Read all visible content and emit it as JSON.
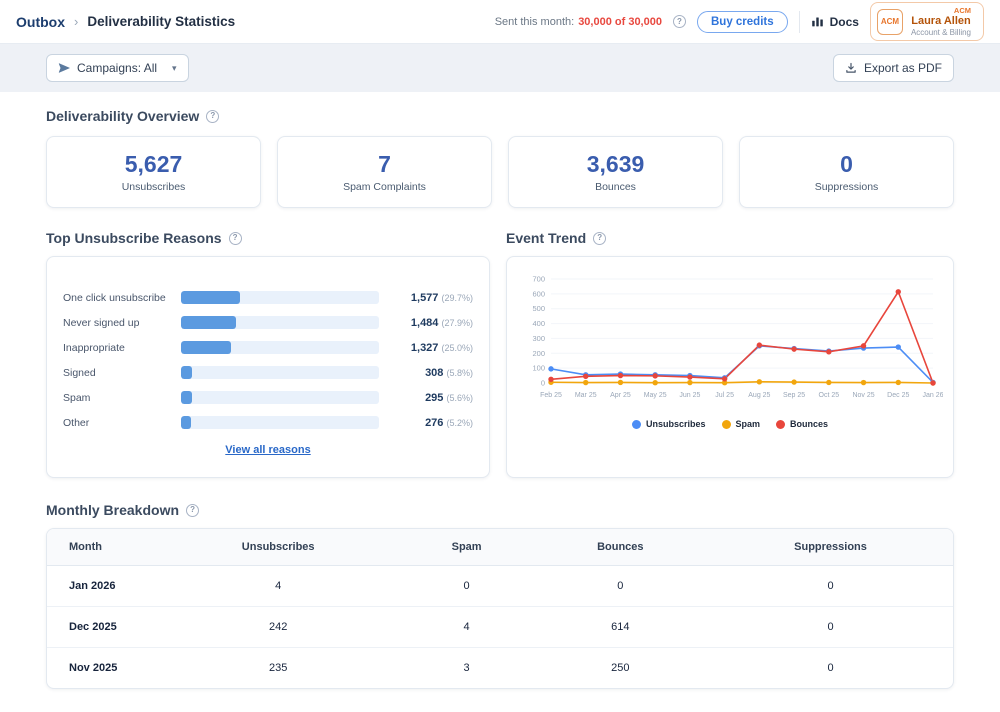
{
  "icons": {
    "info": "?",
    "caret": "▾"
  },
  "header": {
    "breadcrumb": {
      "root": "Outbox",
      "separator": "›",
      "current": "Deliverability Statistics"
    },
    "sent_this_month": {
      "label": "Sent this month:",
      "value": "30,000 of 30,000"
    },
    "buy_credits_label": "Buy credits",
    "docs_label": "Docs",
    "account": {
      "badge": "ACM",
      "org": "ACM",
      "name": "Laura Allen",
      "subtitle": "Account & Billing"
    }
  },
  "filter_bar": {
    "campaigns_filter": "Campaigns: All",
    "export_label": "Export as PDF"
  },
  "overview": {
    "title": "Deliverability Overview",
    "stats": [
      {
        "value": "5,627",
        "label": "Unsubscribes"
      },
      {
        "value": "7",
        "label": "Spam Complaints"
      },
      {
        "value": "3,639",
        "label": "Bounces"
      },
      {
        "value": "0",
        "label": "Suppressions"
      }
    ]
  },
  "reasons": {
    "title": "Top Unsubscribe Reasons",
    "items": [
      {
        "label": "One click unsubscribe",
        "value": "1,577",
        "pct": 29.7
      },
      {
        "label": "Never signed up",
        "value": "1,484",
        "pct": 27.9
      },
      {
        "label": "Inappropriate",
        "value": "1,327",
        "pct": 25.0
      },
      {
        "label": "Signed",
        "value": "308",
        "pct": 5.8
      },
      {
        "label": "Spam",
        "value": "295",
        "pct": 5.6
      },
      {
        "label": "Other",
        "value": "276",
        "pct": 5.2
      }
    ],
    "view_all_label": "View all reasons"
  },
  "event_trend": {
    "title": "Event Trend",
    "chart_data": {
      "type": "line",
      "x": [
        "Feb 25",
        "Mar 25",
        "Apr 25",
        "May 25",
        "Jun 25",
        "Jul 25",
        "Aug 25",
        "Sep 25",
        "Oct 25",
        "Nov 25",
        "Dec 25",
        "Jan 26"
      ],
      "series": [
        {
          "name": "Unsubscribes",
          "color": "#4c8df5",
          "values": [
            95,
            55,
            60,
            55,
            50,
            35,
            250,
            232,
            215,
            235,
            242,
            4
          ]
        },
        {
          "name": "Spam",
          "color": "#f2a60d",
          "values": [
            5,
            3,
            4,
            2,
            3,
            2,
            8,
            6,
            4,
            3,
            4,
            0
          ]
        },
        {
          "name": "Bounces",
          "color": "#e8463c",
          "values": [
            25,
            45,
            50,
            48,
            40,
            28,
            255,
            228,
            210,
            250,
            614,
            0
          ]
        }
      ],
      "ylim": [
        0,
        700
      ],
      "yticks": [
        0,
        100,
        200,
        300,
        400,
        500,
        600,
        700
      ],
      "legend_position": "bottom",
      "grid": true
    }
  },
  "monthly": {
    "title": "Monthly Breakdown",
    "columns": [
      "Month",
      "Unsubscribes",
      "Spam",
      "Bounces",
      "Suppressions"
    ],
    "rows": [
      [
        "Jan 2026",
        "4",
        "0",
        "0",
        "0"
      ],
      [
        "Dec 2025",
        "242",
        "4",
        "614",
        "0"
      ],
      [
        "Nov 2025",
        "235",
        "3",
        "250",
        "0"
      ]
    ]
  },
  "colors": {
    "accent_blue": "#2f74db",
    "stat_value_blue": "#3a5dae",
    "bar_fill_blue": "#5b9ae0",
    "alert_red": "#e8483f",
    "brand_orange": "#e8762c",
    "filter_bar_bg": "#eef1f6"
  }
}
